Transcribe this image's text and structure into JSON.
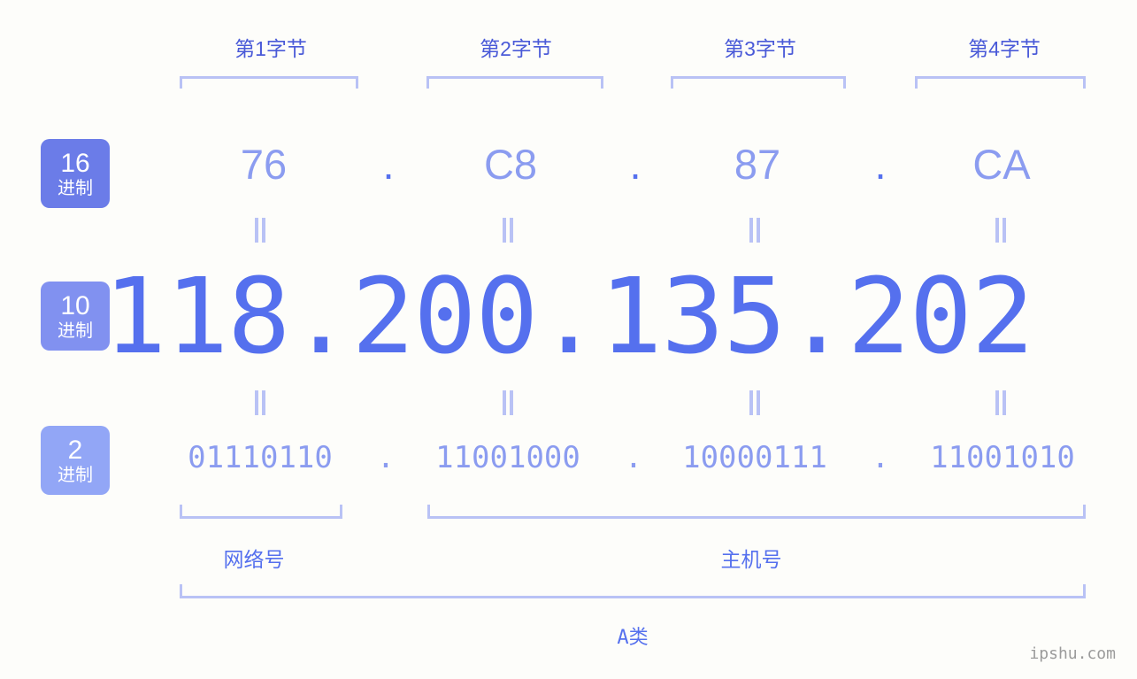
{
  "bytes": {
    "labels": [
      "第1字节",
      "第2字节",
      "第3字节",
      "第4字节"
    ]
  },
  "bases": [
    {
      "number": "16",
      "unit": "进制",
      "color": "#6b7ce8"
    },
    {
      "number": "10",
      "unit": "进制",
      "color": "#8191f0"
    },
    {
      "number": "2",
      "unit": "进制",
      "color": "#92a6f6"
    }
  ],
  "hex": {
    "octets": [
      "76",
      "C8",
      "87",
      "CA"
    ],
    "separator": "."
  },
  "decimal": {
    "address": "118.200.135.202",
    "octets": [
      "118",
      "200",
      "135",
      "202"
    ],
    "separator": "."
  },
  "binary": {
    "octets": [
      "01110110",
      "11001000",
      "10000111",
      "11001010"
    ],
    "separator": "."
  },
  "equals_symbol": "=",
  "sections": {
    "network_label": "网络号",
    "host_label": "主机号",
    "class_label": "A类"
  },
  "watermark": "ipshu.com",
  "colors": {
    "background": "#fdfdfa",
    "accent_strong": "#5570ee",
    "accent_mid": "#8b9cf0",
    "accent_light": "#b9c2f5",
    "byte_label": "#4a5ad8"
  }
}
